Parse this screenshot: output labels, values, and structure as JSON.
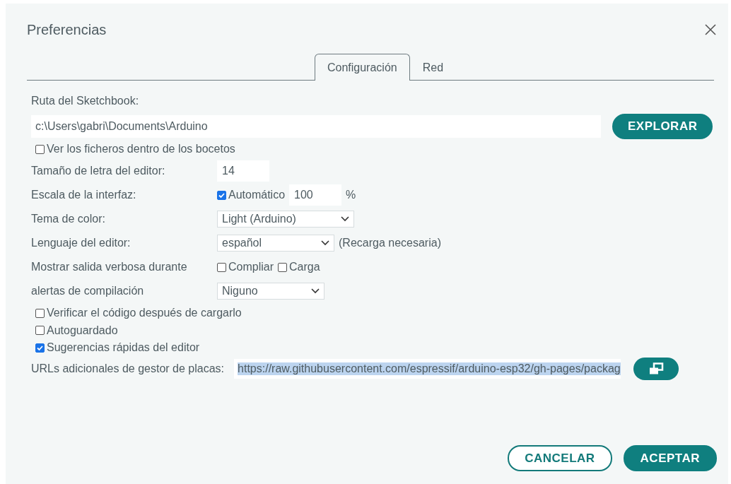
{
  "dialog": {
    "title": "Preferencias"
  },
  "tabs": [
    {
      "label": "Configuración",
      "selected": true
    },
    {
      "label": "Red",
      "selected": false
    }
  ],
  "sketchbook": {
    "label": "Ruta del Sketchbook:",
    "value": "c:\\Users\\gabri\\Documents\\Arduino",
    "button": "EXPLORAR"
  },
  "show_files": {
    "label": "Ver los ficheros dentro de los bocetos",
    "checked": false
  },
  "settings": [
    {
      "kind": "number",
      "label": "Tamaño de letra del editor:",
      "value": "14"
    },
    {
      "kind": "scale",
      "label": "Escala de la interfaz:",
      "auto": {
        "label": "Automático",
        "checked": true
      },
      "value": "100",
      "unit": "%"
    },
    {
      "kind": "select",
      "label": "Tema de color:",
      "value": "Light (Arduino)"
    },
    {
      "kind": "select",
      "label": "Lenguaje del editor:",
      "value": "español",
      "note": "(Recarga necesaria)"
    },
    {
      "kind": "checks",
      "label": "Mostrar salida verbosa durante",
      "options": [
        {
          "label": "Compliar",
          "checked": false
        },
        {
          "label": "Carga",
          "checked": false
        }
      ]
    },
    {
      "kind": "select",
      "label": "alertas de compilación",
      "value": "Niguno"
    }
  ],
  "options": [
    {
      "label": "Verificar el código después de cargarlo",
      "checked": false
    },
    {
      "label": "Autoguardado",
      "checked": false
    },
    {
      "label": "Sugerencias rápidas del editor",
      "checked": true
    }
  ],
  "board_urls": {
    "label": "URLs adicionales de gestor de placas:",
    "value": "https://raw.githubusercontent.com/espressif/arduino-esp32/gh-pages/packag",
    "highlighted": true
  },
  "buttons": [
    {
      "label": "CANCELAR",
      "kind": "outline"
    },
    {
      "label": "ACEPTAR",
      "kind": "filled"
    }
  ]
}
